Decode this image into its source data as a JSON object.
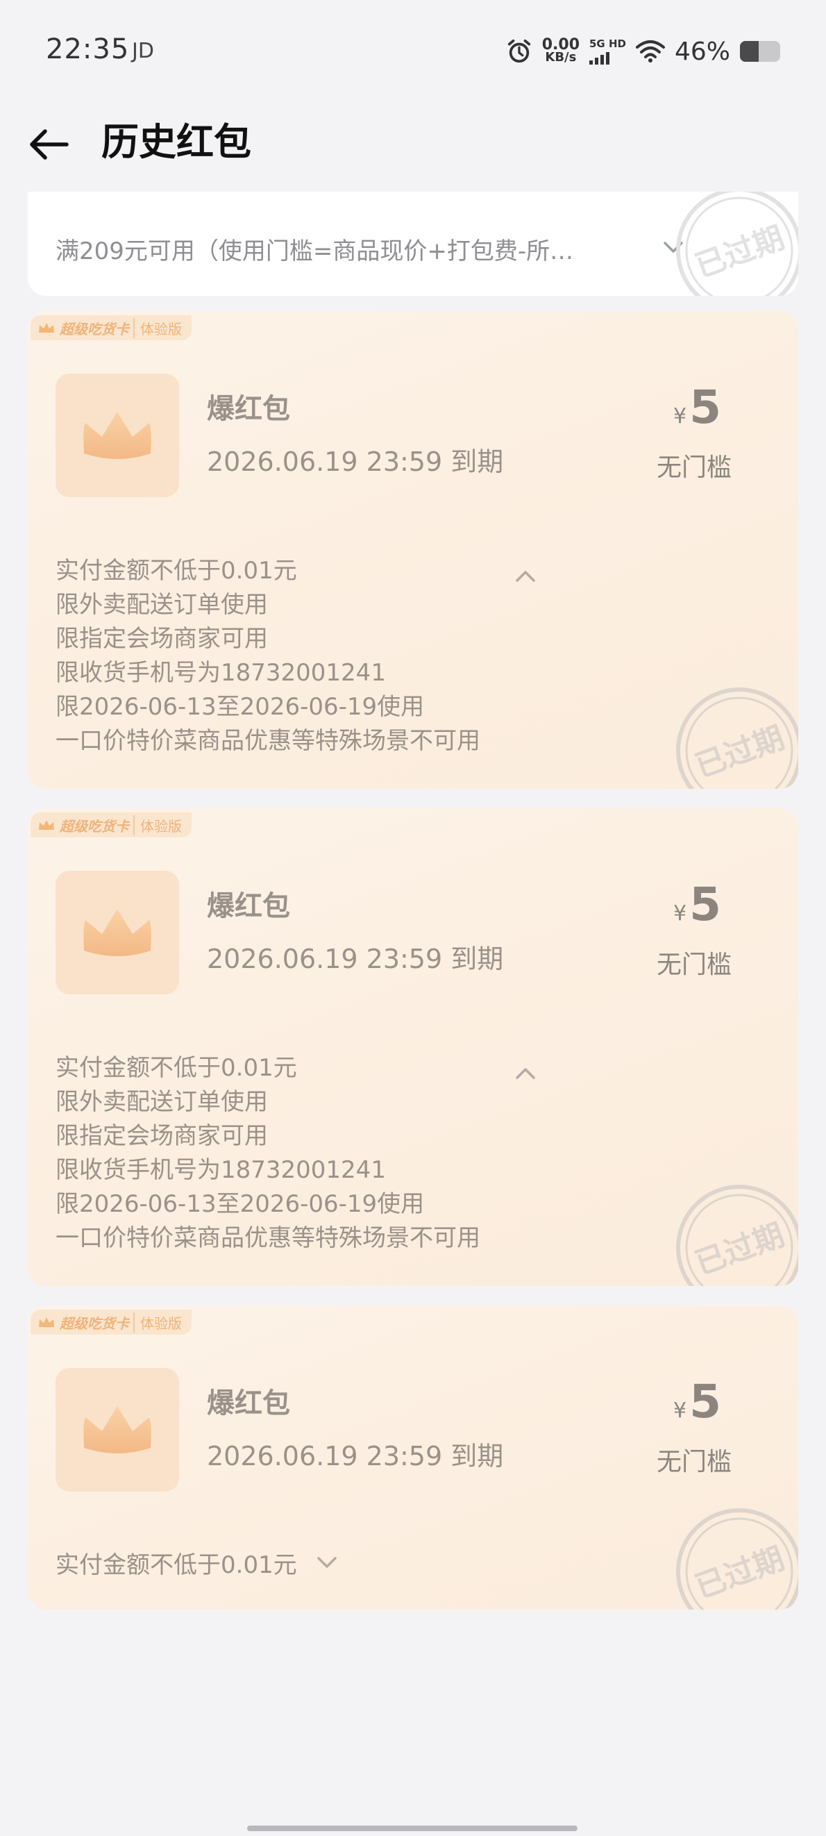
{
  "status_bar": {
    "time": "22:35",
    "carrier": "JD",
    "net_speed": "0.00",
    "net_unit": "KB/s",
    "network": "5G HD",
    "battery_percent": "46%",
    "battery_level": 0.46
  },
  "header": {
    "title": "历史红包",
    "back_icon": "back-arrow-icon"
  },
  "top_card": {
    "condition": "满209元可用（使用门槛=商品现价+打包费-所…",
    "stamp_text": "已过期"
  },
  "coupons": [
    {
      "tag_main": "超级吃货卡",
      "tag_sub": "体验版",
      "name": "爆红包",
      "expiry": "2026.06.19 23:59 到期",
      "currency": "¥",
      "amount": "5",
      "threshold": "无门槛",
      "stamp_text": "已过期",
      "expanded": true,
      "rules": [
        "实付金额不低于0.01元",
        "限外卖配送订单使用",
        "限指定会场商家可用",
        "限收货手机号为18732001241",
        "限2026-06-13至2026-06-19使用",
        "一口价特价菜商品优惠等特殊场景不可用"
      ]
    },
    {
      "tag_main": "超级吃货卡",
      "tag_sub": "体验版",
      "name": "爆红包",
      "expiry": "2026.06.19 23:59 到期",
      "currency": "¥",
      "amount": "5",
      "threshold": "无门槛",
      "stamp_text": "已过期",
      "expanded": true,
      "rules": [
        "实付金额不低于0.01元",
        "限外卖配送订单使用",
        "限指定会场商家可用",
        "限收货手机号为18732001241",
        "限2026-06-13至2026-06-19使用",
        "一口价特价菜商品优惠等特殊场景不可用"
      ]
    },
    {
      "tag_main": "超级吃货卡",
      "tag_sub": "体验版",
      "name": "爆红包",
      "expiry": "2026.06.19 23:59 到期",
      "currency": "¥",
      "amount": "5",
      "threshold": "无门槛",
      "stamp_text": "已过期",
      "expanded": false,
      "rules": [
        "实付金额不低于0.01元"
      ]
    }
  ],
  "colors": {
    "card_bg": "#fcefe1",
    "muted_text": "#9a918a",
    "stamp": "#d6cfc8"
  }
}
